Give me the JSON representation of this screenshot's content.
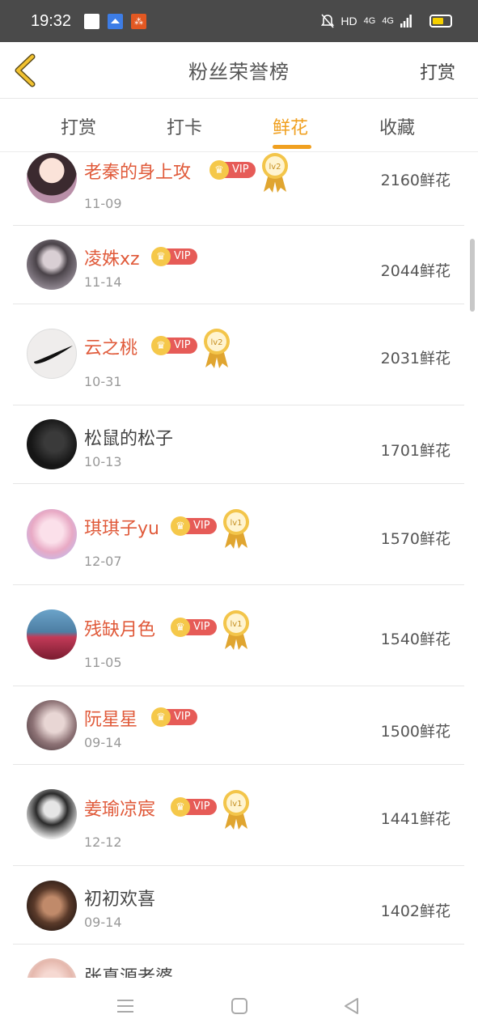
{
  "status_bar": {
    "time": "19:32",
    "network": "HD",
    "signal_1": "4G",
    "signal_2": "4G"
  },
  "header": {
    "title": "粉丝荣誉榜",
    "action": "打赏"
  },
  "tabs": [
    {
      "label": "打赏",
      "active": false
    },
    {
      "label": "打卡",
      "active": false
    },
    {
      "label": "鲜花",
      "active": true
    },
    {
      "label": "收藏",
      "active": false
    }
  ],
  "vip_label": "VIP",
  "rows": [
    {
      "name": "老秦的身上攻",
      "date": "11-09",
      "amount": "2160鲜花",
      "vip": true,
      "level": "lv2"
    },
    {
      "name": "凌姝xz",
      "date": "11-14",
      "amount": "2044鲜花",
      "vip": true,
      "level": ""
    },
    {
      "name": "云之桃",
      "date": "10-31",
      "amount": "2031鲜花",
      "vip": true,
      "level": "lv2"
    },
    {
      "name": "松鼠的松子",
      "date": "10-13",
      "amount": "1701鲜花",
      "vip": false,
      "level": ""
    },
    {
      "name": "琪琪子yu",
      "date": "12-07",
      "amount": "1570鲜花",
      "vip": true,
      "level": "lv1"
    },
    {
      "name": "残缺月色",
      "date": "11-05",
      "amount": "1540鲜花",
      "vip": true,
      "level": "lv1"
    },
    {
      "name": "阮星星",
      "date": "09-14",
      "amount": "1500鲜花",
      "vip": true,
      "level": ""
    },
    {
      "name": "姜瑜凉宸",
      "date": "12-12",
      "amount": "1441鲜花",
      "vip": true,
      "level": "lv1"
    },
    {
      "name": "初初欢喜",
      "date": "09-14",
      "amount": "1402鲜花",
      "vip": false,
      "level": ""
    },
    {
      "name": "张真源老婆",
      "date": "",
      "amount": "",
      "vip": false,
      "level": ""
    }
  ],
  "colors": {
    "accent": "#f0a020",
    "vip_name": "#e05a3a",
    "vip_pill": "#e65b57",
    "status_bar": "#4a4a4a"
  }
}
